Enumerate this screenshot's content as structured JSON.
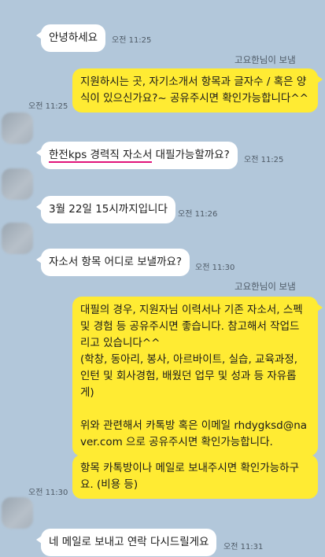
{
  "messages": [
    {
      "text": "안녕하세요",
      "time": "오전 11:25"
    },
    {
      "sender": "고요한님이 보냄",
      "lines": [
        "지원하시는 곳, 자기소개서 항목과 글자수 / 혹은 양",
        "식이 있으신가요?~ 공유주시면 확인가능합니다^^"
      ],
      "time": "오전 11:25"
    },
    {
      "text_underlined": "한전kps 경력직 자소서",
      "text_rest": " 대필가능할까요?",
      "time": "오전 11:25"
    },
    {
      "text": "3월 22일 15시까지입니다",
      "time": "오전 11:26"
    },
    {
      "text": "자소서 항목 어디로 보낼까요?",
      "time": "오전 11:30"
    },
    {
      "sender": "고요한님이 보냄",
      "lines": [
        "대필의 경우, 지원자님 이력서나 기존 자소서, 스펙",
        "및 경험 등 공유주시면 좋습니다. 참고해서 작업드",
        "리고 있습니다^^",
        "(학창, 동아리, 봉사, 아르바이트, 실습, 교육과정,",
        "인턴 및 회사경험, 배웠던 업무 및 성과 등 자유롭",
        "게)",
        "",
        "위와 관련해서 카톡방 혹은 이메일 rhdygksd@na",
        "ver.com 으로 공유주시면 확인가능합니다."
      ]
    },
    {
      "lines": [
        "항목 카톡방이나 메일로 보내주시면 확인가능하구",
        "요. (비용 등)"
      ],
      "time": "오전 11:30"
    },
    {
      "text": "네 메일로 보내고 연락 다시드릴게요",
      "time": "오전 11:31"
    }
  ]
}
